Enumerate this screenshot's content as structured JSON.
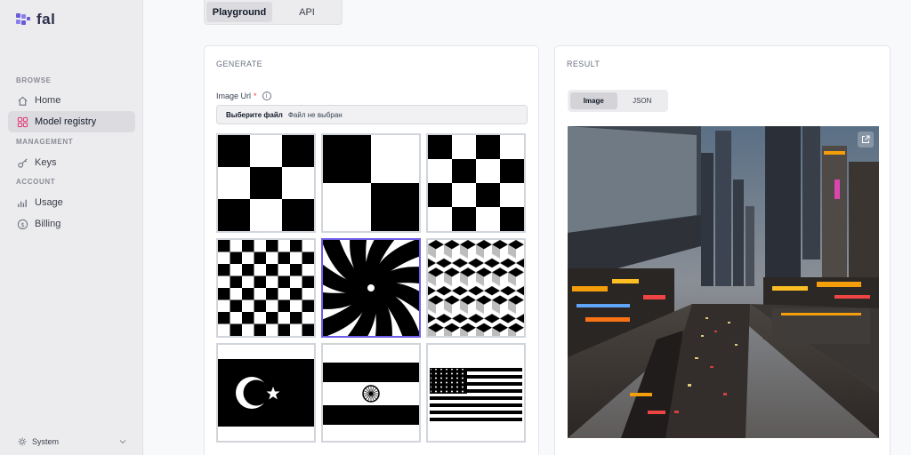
{
  "brand": {
    "name": "fal"
  },
  "sidebar": {
    "sections": {
      "browse": "BROWSE",
      "management": "MANAGEMENT",
      "account": "ACCOUNT"
    },
    "items": [
      {
        "label": "Home",
        "icon": "home-icon",
        "active": false
      },
      {
        "label": "Model registry",
        "icon": "grid-icon",
        "active": true
      },
      {
        "label": "Keys",
        "icon": "key-icon",
        "active": false
      },
      {
        "label": "Usage",
        "icon": "bar-chart-icon",
        "active": false
      },
      {
        "label": "Billing",
        "icon": "dollar-icon",
        "active": false
      }
    ],
    "theme": {
      "label": "System",
      "icon": "sun-icon"
    }
  },
  "top_tabs": [
    {
      "label": "Playground",
      "active": true
    },
    {
      "label": "API",
      "active": false
    }
  ],
  "generate": {
    "title": "GENERATE",
    "image_url": {
      "label": "Image Url",
      "required_mark": "*",
      "info_glyph": "i",
      "file_button": "Выберите файл",
      "file_status": "Файл не выбран"
    },
    "presets": [
      {
        "name": "checker-3x3",
        "selected": false
      },
      {
        "name": "checker-2x2",
        "selected": false
      },
      {
        "name": "checker-4x4",
        "selected": false
      },
      {
        "name": "checker-8x8",
        "selected": false
      },
      {
        "name": "spiral",
        "selected": true
      },
      {
        "name": "isometric-cubes",
        "selected": false
      },
      {
        "name": "turkey-flag",
        "selected": false
      },
      {
        "name": "india-flag",
        "selected": false
      },
      {
        "name": "usa-flag",
        "selected": false
      }
    ]
  },
  "result": {
    "title": "RESULT",
    "view_tabs": [
      {
        "label": "Image",
        "active": true
      },
      {
        "label": "JSON",
        "active": false
      }
    ],
    "open_icon": "external-link-icon"
  },
  "colors": {
    "accent": "#6d5ce7",
    "required": "#ef4444",
    "logo": "#6a5cd6"
  }
}
